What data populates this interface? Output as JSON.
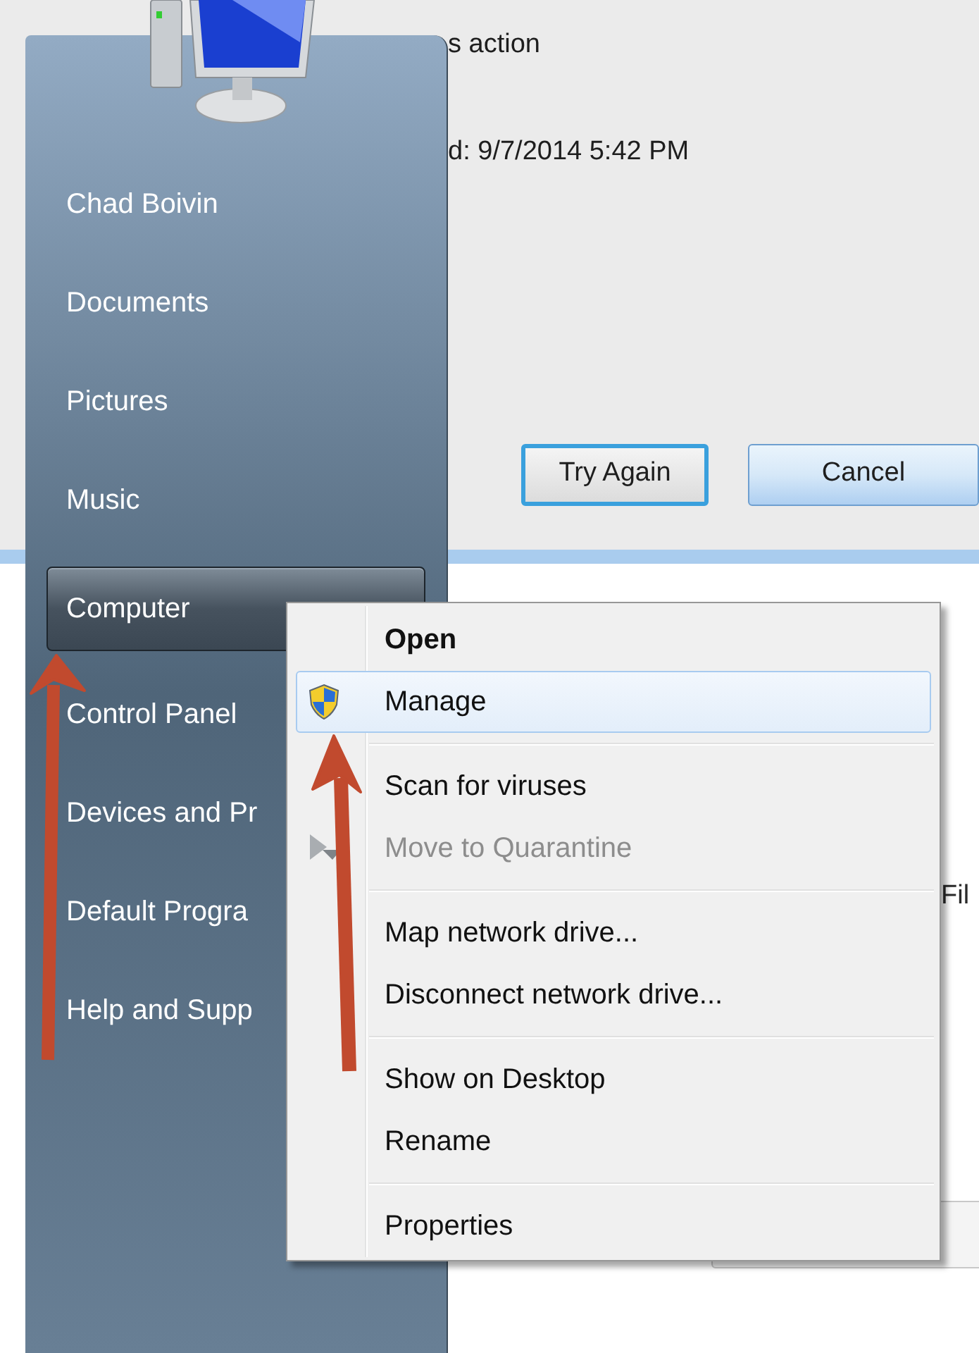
{
  "dialog": {
    "texts": [
      "s action",
      "d: 9/7/2014 5:42 PM"
    ],
    "buttons": [
      {
        "label": "Try Again",
        "kind": "focused"
      },
      {
        "label": "Cancel",
        "kind": "hovered"
      }
    ],
    "side_text": "Fil"
  },
  "start_menu": {
    "items": [
      {
        "label": "Chad Boivin",
        "selected": false
      },
      {
        "label": "Documents",
        "selected": false
      },
      {
        "label": "Pictures",
        "selected": false
      },
      {
        "label": "Music",
        "selected": false
      },
      {
        "label": "Computer",
        "selected": true
      },
      {
        "label": "Control Panel",
        "selected": false
      },
      {
        "label": "Devices and Pr",
        "selected": false
      },
      {
        "label": "Default Progra",
        "selected": false
      },
      {
        "label": "Help and Supp",
        "selected": false
      }
    ]
  },
  "context_menu": {
    "groups": [
      [
        {
          "label": "Open",
          "bold": true,
          "selected": false,
          "disabled": false,
          "kind": "plain"
        },
        {
          "label": "Manage",
          "bold": false,
          "selected": true,
          "disabled": false,
          "kind": "elevated"
        }
      ],
      [
        {
          "label": "Scan for viruses",
          "bold": false,
          "selected": false,
          "disabled": false,
          "kind": "plain"
        },
        {
          "label": "Move to Quarantine",
          "bold": false,
          "selected": false,
          "disabled": true,
          "kind": "antivirus"
        }
      ],
      [
        {
          "label": "Map network drive...",
          "bold": false,
          "selected": false,
          "disabled": false,
          "kind": "plain"
        },
        {
          "label": "Disconnect network drive...",
          "bold": false,
          "selected": false,
          "disabled": false,
          "kind": "plain"
        }
      ],
      [
        {
          "label": "Show on Desktop",
          "bold": false,
          "selected": false,
          "disabled": false,
          "kind": "plain"
        },
        {
          "label": "Rename",
          "bold": false,
          "selected": false,
          "disabled": false,
          "kind": "plain"
        }
      ],
      [
        {
          "label": "Properties",
          "bold": false,
          "selected": false,
          "disabled": false,
          "kind": "plain"
        }
      ]
    ]
  }
}
